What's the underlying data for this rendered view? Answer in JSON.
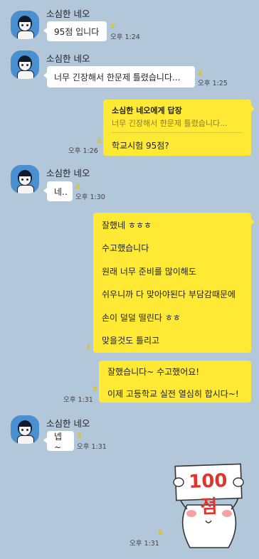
{
  "sender_name": "소심한 네오",
  "messages": {
    "m1": {
      "text": "95점 입니다",
      "unread": "2",
      "time": "오후 1:24"
    },
    "m2": {
      "text": "너무 긴장해서 한문제 틀렸습니다...",
      "unread": "2",
      "time": "오후 1:25"
    },
    "reply": {
      "header": "소심한 네오에게 답장",
      "quote": "너무 긴장해서 한문제 틀렸습니다...",
      "text": "학교시험 95점?",
      "unread": "2",
      "time": "오후 1:26"
    },
    "m3": {
      "text": "네..",
      "unread": "2",
      "time": "오후 1:30"
    },
    "out_block": {
      "lines": [
        "잘했네 ㅎㅎㅎ",
        "수고했습니다",
        "원래 너무 준비를 많이해도",
        "쉬우니까 다 맞아야된다 부담감때문에",
        "손이 덜덜 떨린다 ㅎㅎ",
        "맞을것도 틀리고"
      ],
      "unread": "3"
    },
    "out_block2": {
      "lines": [
        "잘했습니다~ 수고했어요!",
        "이제 고등학교 실전 열심히 합시다~!"
      ],
      "unread": "3",
      "time": "오후 1:31"
    },
    "m4": {
      "text": "넵~",
      "unread": "3",
      "time": "오후 1:31"
    },
    "sticker": {
      "sign_text": "100점",
      "unread": "3",
      "time": "오후 1:31"
    }
  },
  "colors": {
    "background": "#b2c7d9",
    "outgoing": "#fee934",
    "incoming": "#ffffff",
    "unread": "#e5c000",
    "sticker_text": "#e0342c"
  }
}
